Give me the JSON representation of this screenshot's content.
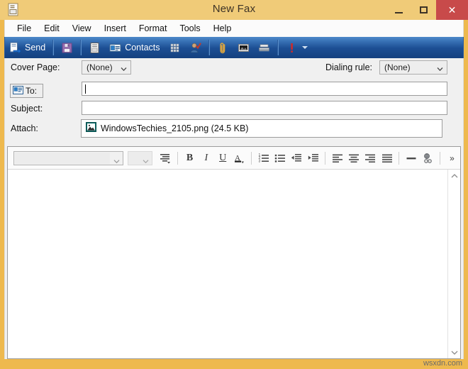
{
  "window": {
    "title": "New Fax",
    "icon": "fax-document-icon",
    "caption": {
      "minimize": "–",
      "maximize": "□",
      "close": "✕"
    },
    "frame_color": "#eeb94e",
    "close_color": "#c84a4a"
  },
  "menubar": {
    "items": [
      {
        "label": "File"
      },
      {
        "label": "Edit"
      },
      {
        "label": "View"
      },
      {
        "label": "Insert"
      },
      {
        "label": "Format"
      },
      {
        "label": "Tools"
      },
      {
        "label": "Help"
      }
    ]
  },
  "toolbar": {
    "background_color": "#1d4f94",
    "send_label": "Send",
    "contacts_label": "Contacts",
    "buttons": [
      {
        "name": "send-button",
        "icon": "send-icon",
        "label": "Send"
      },
      {
        "name": "save-button",
        "icon": "floppy-disk-icon",
        "label": ""
      },
      {
        "name": "print-button",
        "icon": "document-icon",
        "label": ""
      },
      {
        "name": "contacts-button",
        "icon": "contact-card-icon",
        "label": "Contacts"
      },
      {
        "name": "dial-pad-button",
        "icon": "keypad-icon",
        "label": ""
      },
      {
        "name": "check-names-button",
        "icon": "person-check-icon",
        "label": ""
      },
      {
        "name": "attach-file-button",
        "icon": "paperclip-icon",
        "label": ""
      },
      {
        "name": "insert-picture-button",
        "icon": "picture-icon",
        "label": ""
      },
      {
        "name": "scan-button",
        "icon": "scanner-icon",
        "label": ""
      },
      {
        "name": "priority-button",
        "icon": "exclamation-icon",
        "label": ""
      }
    ]
  },
  "fields": {
    "cover_page": {
      "label": "Cover Page:",
      "value": "(None)"
    },
    "dialing_rule": {
      "label": "Dialing rule:",
      "value": "(None)"
    },
    "to": {
      "button_label": "To:",
      "value": "",
      "placeholder": ""
    },
    "subject": {
      "label": "Subject:",
      "value": "",
      "placeholder": ""
    },
    "attach": {
      "label": "Attach:",
      "file_name": "WindowsTechies_2105.png (24.5 KB)",
      "icon": "image-file-icon"
    }
  },
  "editor": {
    "font_family_value": "",
    "font_size_value": "",
    "body_text": "",
    "format_buttons": [
      {
        "name": "paragraph-style-button",
        "icon": "paragraph-style-icon",
        "glyph": "≣"
      },
      {
        "name": "bold-button",
        "icon": "bold-icon",
        "glyph": "B"
      },
      {
        "name": "italic-button",
        "icon": "italic-icon",
        "glyph": "I"
      },
      {
        "name": "underline-button",
        "icon": "underline-icon",
        "glyph": "U"
      },
      {
        "name": "font-color-button",
        "icon": "font-color-icon",
        "glyph": "A"
      },
      {
        "name": "numbered-list-button",
        "icon": "numbered-list-icon",
        "glyph": ""
      },
      {
        "name": "bulleted-list-button",
        "icon": "bulleted-list-icon",
        "glyph": ""
      },
      {
        "name": "decrease-indent-button",
        "icon": "decrease-indent-icon",
        "glyph": ""
      },
      {
        "name": "increase-indent-button",
        "icon": "increase-indent-icon",
        "glyph": ""
      },
      {
        "name": "align-left-button",
        "icon": "align-left-icon",
        "glyph": ""
      },
      {
        "name": "align-center-button",
        "icon": "align-center-icon",
        "glyph": ""
      },
      {
        "name": "align-right-button",
        "icon": "align-right-icon",
        "glyph": ""
      },
      {
        "name": "justify-button",
        "icon": "justify-icon",
        "glyph": ""
      },
      {
        "name": "horizontal-rule-button",
        "icon": "horizontal-rule-icon",
        "glyph": "—"
      },
      {
        "name": "insert-hyperlink-button",
        "icon": "hyperlink-icon",
        "glyph": ""
      },
      {
        "name": "overflow-button",
        "icon": "chevron-double-right-icon",
        "glyph": "»"
      }
    ],
    "scrollbar": {
      "up_glyph": "⌃",
      "down_glyph": "⌄"
    }
  },
  "watermark": {
    "text": "wsxdn.com"
  }
}
